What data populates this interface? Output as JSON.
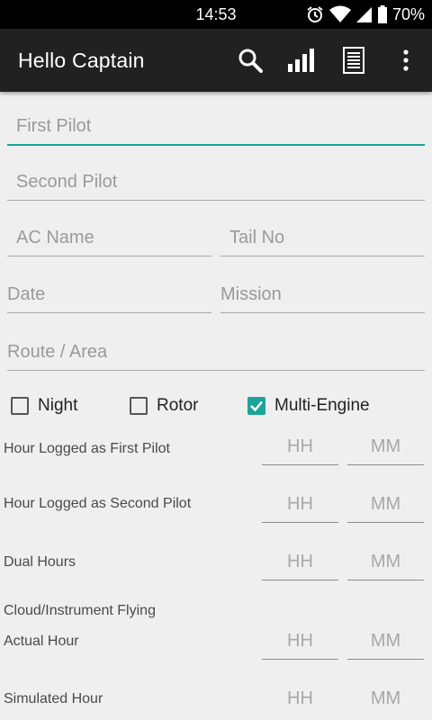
{
  "status_bar": {
    "time": "14:53",
    "battery": "70%",
    "icons": [
      "alarm-icon",
      "wifi-icon",
      "signal-icon",
      "battery-icon"
    ]
  },
  "app_bar": {
    "title": "Hello Captain",
    "actions": [
      "search-icon",
      "stats-icon",
      "list-icon",
      "overflow-menu-icon"
    ]
  },
  "form": {
    "first_pilot": "First Pilot",
    "second_pilot": "Second Pilot",
    "ac_name": "AC Name",
    "tail_no": "Tail No",
    "date": "Date",
    "mission": "Mission",
    "route_area": "Route / Area"
  },
  "checkboxes": {
    "night": {
      "label": "Night",
      "checked": false
    },
    "rotor": {
      "label": "Rotor",
      "checked": false
    },
    "multi_engine": {
      "label": "Multi-Engine",
      "checked": true
    }
  },
  "hours": {
    "section_cloud": "Cloud/Instrument Flying",
    "hh_placeholder": "HH",
    "mm_placeholder": "MM",
    "rows": [
      {
        "label": "Hour Logged as First Pilot"
      },
      {
        "label": "Hour Logged as Second Pilot"
      },
      {
        "label": "Dual Hours"
      },
      {
        "label": "Actual Hour"
      },
      {
        "label": "Simulated Hour"
      }
    ]
  },
  "colors": {
    "accent": "#1aa59a",
    "app_bar": "#212121",
    "background": "#efefef"
  }
}
